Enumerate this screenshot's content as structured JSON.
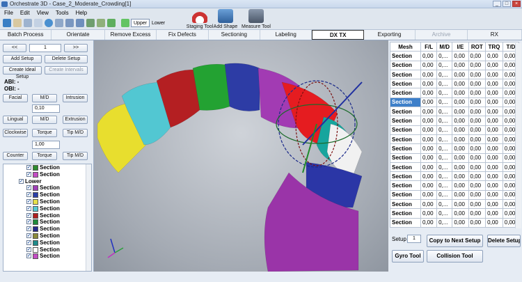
{
  "window": {
    "title": "Orchestrate 3D - Case_2_Moderate_Crowding[1]",
    "min": "_",
    "max": "□",
    "close": "×"
  },
  "menu": [
    "File",
    "Edit",
    "View",
    "Tools",
    "Help"
  ],
  "toolbar": {
    "upper_label": "Upper",
    "lower_label": "Lower",
    "staging_tool": "Staging Tool",
    "add_shape": "Add Shape",
    "measure_tool": "Measure Tool"
  },
  "tabs": [
    {
      "label": "Batch Process",
      "state": "normal"
    },
    {
      "label": "Orientate",
      "state": "normal"
    },
    {
      "label": "Remove Excess",
      "state": "normal"
    },
    {
      "label": "Fix Defects",
      "state": "normal"
    },
    {
      "label": "Sectioning",
      "state": "normal"
    },
    {
      "label": "Labeling",
      "state": "normal"
    },
    {
      "label": "DX TX",
      "state": "active"
    },
    {
      "label": "Exporting",
      "state": "normal"
    },
    {
      "label": "Archive",
      "state": "disabled"
    },
    {
      "label": "RX",
      "state": "normal"
    }
  ],
  "left": {
    "prev": "<<",
    "step_value": "1",
    "next": ">>",
    "add_setup": "Add Setup",
    "delete_setup": "Delete Setup",
    "create_ideal": "Create Ideal Setup",
    "create_intervals": "Create Intervals",
    "abi": "ABI: -",
    "obi": "OBI: -",
    "facial": "Facial",
    "md1": "M/D",
    "intrusion": "Intrusion",
    "value1": "0,10",
    "lingual": "Lingual",
    "md2": "M/D",
    "extrusion": "Extrusion",
    "clockwise": "Clockwise",
    "torque1": "Torque",
    "tipmd1": "Tip M/D",
    "value2": "1,00",
    "counter": "Counter",
    "torque2": "Torque",
    "tipmd2": "Tip M/D"
  },
  "tree": [
    {
      "label": "Section",
      "color": "#2e8b2e"
    },
    {
      "label": "Section",
      "color": "#c44cc4"
    },
    {
      "label": "Lower",
      "color": ""
    },
    {
      "label": "Section",
      "color": "#a040b8"
    },
    {
      "label": "Section",
      "color": "#2b3fa8"
    },
    {
      "label": "Section",
      "color": "#e6e04a"
    },
    {
      "label": "Section",
      "color": "#56c8d2"
    },
    {
      "label": "Section",
      "color": "#b01f1f"
    },
    {
      "label": "Section",
      "color": "#1f8a3a"
    },
    {
      "label": "Section",
      "color": "#262a8c"
    },
    {
      "label": "Section",
      "color": "#8a8a3a"
    },
    {
      "label": "Section",
      "color": "#1f8a8a"
    },
    {
      "label": "Section",
      "color": "#ffffff"
    },
    {
      "label": "Section",
      "color": "#c44cc4"
    }
  ],
  "grid": {
    "headers": [
      "Mesh",
      "F/L",
      "M/D",
      "I/E",
      "ROT",
      "TRQ",
      "T/D"
    ],
    "rows": [
      [
        "Section",
        "0,00",
        "0,...",
        "0,00",
        "0,00",
        "0,00",
        "0,00"
      ],
      [
        "Section",
        "0,00",
        "0,...",
        "0,00",
        "0,00",
        "0,00",
        "0,00"
      ],
      [
        "Section",
        "0,00",
        "0,...",
        "0,00",
        "0,00",
        "0,00",
        "0,00"
      ],
      [
        "Section",
        "0,00",
        "0,...",
        "0,00",
        "0,00",
        "0,00",
        "0,00"
      ],
      [
        "Section",
        "0,00",
        "0,...",
        "0,00",
        "0,00",
        "0,00",
        "0,00"
      ],
      [
        "Section",
        "0,00",
        "0,...",
        "0,00",
        "0,00",
        "0,00",
        "0,00"
      ],
      [
        "Section",
        "0,00",
        "0,...",
        "0,00",
        "0,00",
        "0,00",
        "0,00"
      ],
      [
        "Section",
        "0,00",
        "0,...",
        "0,00",
        "0,00",
        "0,00",
        "0,00"
      ],
      [
        "Section",
        "0,00",
        "0,...",
        "0,00",
        "0,00",
        "0,00",
        "0,00"
      ],
      [
        "Section",
        "0,00",
        "0,...",
        "0,00",
        "0,00",
        "0,00",
        "0,00"
      ],
      [
        "Section",
        "0,00",
        "0,...",
        "0,00",
        "0,00",
        "0,00",
        "0,00"
      ],
      [
        "Section",
        "0,00",
        "0,...",
        "0,00",
        "0,00",
        "0,00",
        "0,00"
      ],
      [
        "Section",
        "0,00",
        "0,...",
        "0,00",
        "0,00",
        "0,00",
        "0,00"
      ],
      [
        "Section",
        "0,00",
        "0,...",
        "0,00",
        "0,00",
        "0,00",
        "0,00"
      ],
      [
        "Section",
        "0,00",
        "0,...",
        "0,00",
        "0,00",
        "0,00",
        "0,00"
      ],
      [
        "Section",
        "0,00",
        "0,...",
        "0,00",
        "0,00",
        "0,00",
        "0,00"
      ],
      [
        "Section",
        "0,00",
        "0,...",
        "0,00",
        "0,00",
        "0,00",
        "0,00"
      ],
      [
        "Section",
        "0,00",
        "0,...",
        "0,00",
        "0,00",
        "0,00",
        "0,00"
      ],
      [
        "Section",
        "0,00",
        "0,...",
        "0,00",
        "0,00",
        "0,00",
        "0,00"
      ]
    ],
    "selected_row": 5
  },
  "right": {
    "setup_label": "Setup",
    "setup_value": "1",
    "copy_next": "Copy to Next Setup",
    "delete_setup": "Delete Setup",
    "gyro": "Gyro Tool",
    "collision": "Collision Tool"
  },
  "colors": {
    "accent": "#3d7fc9",
    "active_tab_border": "#333333"
  }
}
